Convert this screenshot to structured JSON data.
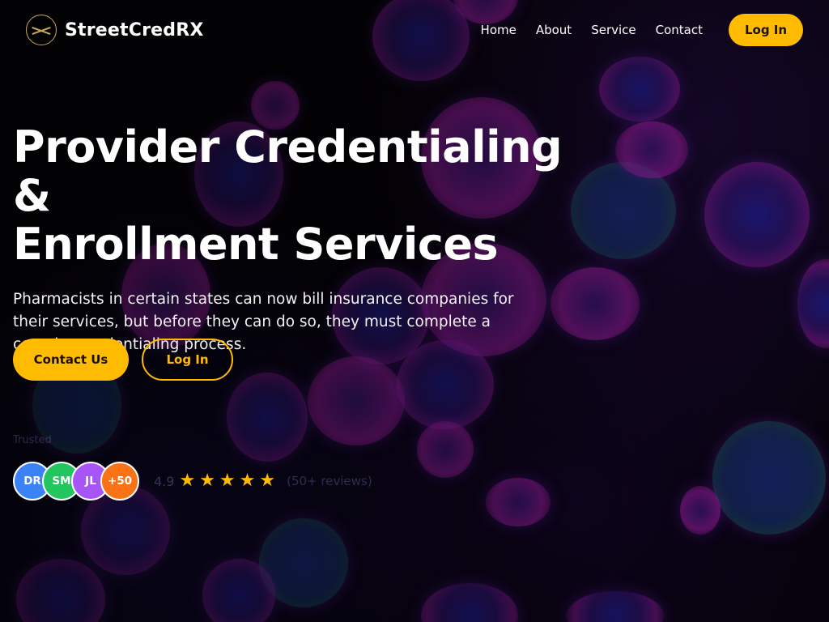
{
  "brand": {
    "name": "StreetCredRX",
    "logo_icon": "compass-logo-icon"
  },
  "nav": {
    "links": [
      "Home",
      "About",
      "Service",
      "Contact"
    ],
    "login_label": "Log In"
  },
  "hero": {
    "title_line1": "Provider Credentialing &",
    "title_line2": "Enrollment Services",
    "description": "Pharmacists in certain states can now bill insurance companies for their services, but before they can do so, they must complete a complex credentialing process."
  },
  "cta": {
    "contact_label": "Contact Us",
    "login_label": "Log In"
  },
  "social_proof": {
    "trust_label": "Trusted",
    "avatars": [
      {
        "initials": "DR",
        "color": "#3b82f6"
      },
      {
        "initials": "SM",
        "color": "#22c55e"
      },
      {
        "initials": "JL",
        "color": "#a855f7"
      },
      {
        "initials": "+50",
        "color": "#f97316"
      }
    ],
    "rating_score": "4.9",
    "stars": 5,
    "rating_count": "(50+ reviews)"
  },
  "colors": {
    "accent": "#ffbb00",
    "background": "#050208",
    "logo_gold": "#c9a959"
  }
}
